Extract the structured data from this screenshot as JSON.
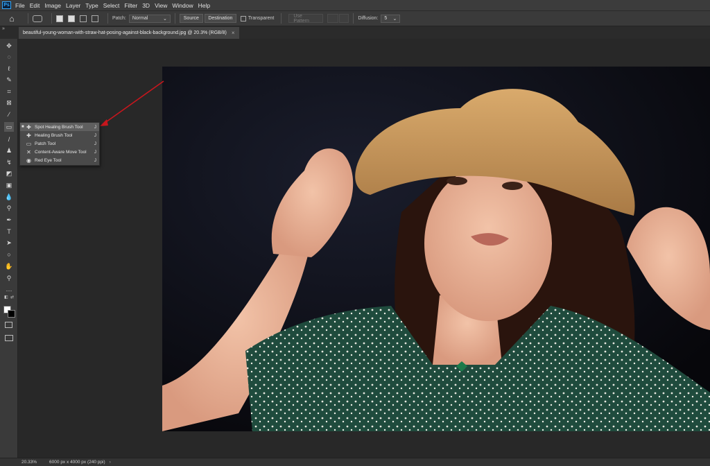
{
  "app": {
    "logo_text": "Ps",
    "menu": [
      "File",
      "Edit",
      "Image",
      "Layer",
      "Type",
      "Select",
      "Filter",
      "3D",
      "View",
      "Window",
      "Help"
    ]
  },
  "options": {
    "patch_label": "Patch:",
    "patch_value": "Normal",
    "source_button": "Source",
    "destination_button": "Destination",
    "transparent_label": "Transparent",
    "use_pattern_button": "Use Pattern",
    "diffusion_label": "Diffusion:",
    "diffusion_value": "5"
  },
  "document": {
    "tab_title": "beautiful-young-woman-with-straw-hat-posing-against-black-background.jpg @ 20.3% (RGB/8)",
    "close_glyph": "×",
    "collapse_glyph": "»"
  },
  "toolbar": {
    "tools": [
      {
        "name": "move-tool",
        "glyph": "✥"
      },
      {
        "name": "marquee-tool",
        "glyph": "◌"
      },
      {
        "name": "lasso-tool",
        "glyph": "ℓ"
      },
      {
        "name": "quick-selection-tool",
        "glyph": "✎"
      },
      {
        "name": "crop-tool",
        "glyph": "⌗"
      },
      {
        "name": "frame-tool",
        "glyph": "⊠"
      },
      {
        "name": "eyedropper-tool",
        "glyph": "⁄"
      },
      {
        "name": "healing-tool",
        "glyph": "▭"
      },
      {
        "name": "brush-tool",
        "glyph": "/"
      },
      {
        "name": "stamp-tool",
        "glyph": "♟"
      },
      {
        "name": "history-brush-tool",
        "glyph": "↯"
      },
      {
        "name": "eraser-tool",
        "glyph": "◩"
      },
      {
        "name": "gradient-tool",
        "glyph": "▣"
      },
      {
        "name": "blur-tool",
        "glyph": "💧"
      },
      {
        "name": "dodge-tool",
        "glyph": "⚲"
      },
      {
        "name": "pen-tool",
        "glyph": "✒"
      },
      {
        "name": "type-tool",
        "glyph": "T"
      },
      {
        "name": "path-selection-tool",
        "glyph": "➤"
      },
      {
        "name": "shape-tool",
        "glyph": "○"
      },
      {
        "name": "hand-tool",
        "glyph": "✋"
      },
      {
        "name": "zoom-tool",
        "glyph": "⚲"
      },
      {
        "name": "more-tools",
        "glyph": "···"
      }
    ]
  },
  "flyout": {
    "items": [
      {
        "label": "Spot Healing Brush Tool",
        "key": "J",
        "glyph": "✚"
      },
      {
        "label": "Healing Brush Tool",
        "key": "J",
        "glyph": "✚"
      },
      {
        "label": "Patch Tool",
        "key": "J",
        "glyph": "▭"
      },
      {
        "label": "Content-Aware Move Tool",
        "key": "J",
        "glyph": "✕"
      },
      {
        "label": "Red Eye Tool",
        "key": "J",
        "glyph": "◉"
      }
    ],
    "bullet": "■"
  },
  "status": {
    "zoom": "20.33%",
    "dims": "6000 px x 4000 px (240 ppi)",
    "arrow": "›"
  },
  "colors": {
    "accent_arrow": "#c8161d",
    "ps_blue": "#31a8ff"
  }
}
